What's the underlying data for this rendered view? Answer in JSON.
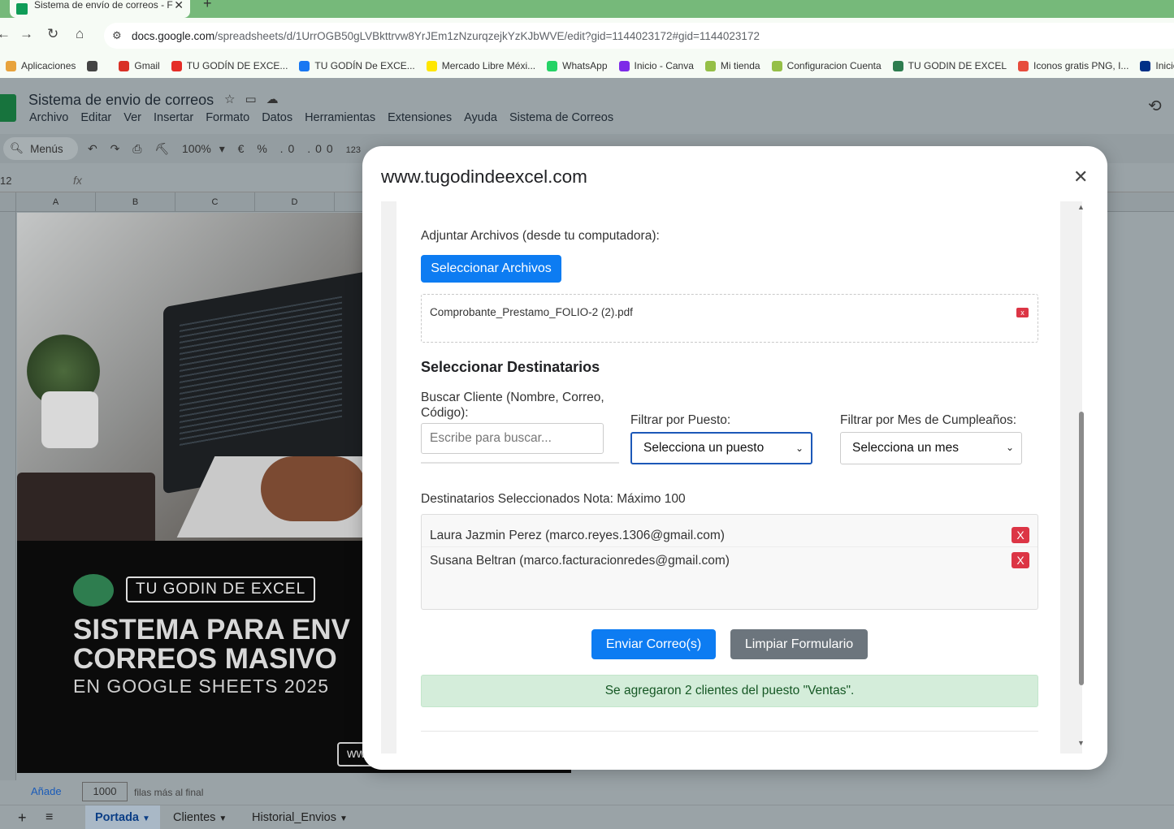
{
  "browser": {
    "tab_title": "Sistema de envío de correos - F",
    "tab_close": "✕",
    "new_tab": "+",
    "url_domain": "docs.google.com",
    "url_path": "/spreadsheets/d/1UrrOGB50gLVBkttrvw8YrJEm1zNzurqzejkYzKJbWVE/edit?gid=1144023172#gid=1144023172",
    "bookmarks": [
      {
        "label": "Aplicaciones",
        "color": "#e8a33d"
      },
      {
        "label": "",
        "color": "#444444"
      },
      {
        "label": "Gmail",
        "color": "#d93025"
      },
      {
        "label": "TU GODÍN DE EXCE...",
        "color": "#e52d27"
      },
      {
        "label": "TU GODÍN De EXCE...",
        "color": "#1877f2"
      },
      {
        "label": "Mercado Libre Méxi...",
        "color": "#ffe600"
      },
      {
        "label": "WhatsApp",
        "color": "#25d366"
      },
      {
        "label": "Inicio - Canva",
        "color": "#7d2ae8"
      },
      {
        "label": "Mi tienda",
        "color": "#95bf47"
      },
      {
        "label": "Configuracion Cuenta",
        "color": "#95bf47"
      },
      {
        "label": "TU GODIN DE EXCEL",
        "color": "#2e7d4f"
      },
      {
        "label": "Iconos gratis PNG, I...",
        "color": "#e74c3c"
      },
      {
        "label": "Inicio - Pa",
        "color": "#003087"
      }
    ]
  },
  "sheets": {
    "doc_title": "Sistema de envio de correos",
    "menu": [
      "Archivo",
      "Editar",
      "Ver",
      "Insertar",
      "Formato",
      "Datos",
      "Herramientas",
      "Extensiones",
      "Ayuda",
      "Sistema de Correos"
    ],
    "search_label": "Menús",
    "zoom": "100%",
    "currency": "€",
    "percent": "%",
    "number_format": "123",
    "name_box": "12",
    "fx": "fx",
    "columns": [
      "A",
      "B",
      "C",
      "D"
    ],
    "banner": {
      "badge": "TU GODIN DE EXCEL",
      "title_line1": "SISTEMA PARA ENV",
      "title_line2": "CORREOS MASIVO",
      "subtitle": "EN GOOGLE SHEETS 2025",
      "web": "ww"
    },
    "add_rows_label": "Añade",
    "add_rows_value": "1000",
    "add_rows_suffix": "filas más al final",
    "sheet_tabs": [
      "Portada",
      "Clientes",
      "Historial_Envios"
    ]
  },
  "modal": {
    "title": "www.tugodindeexcel.com",
    "close": "✕",
    "attach_label": "Adjuntar Archivos (desde tu computadora):",
    "select_files_button": "Seleccionar Archivos",
    "attached_file": "Comprobante_Prestamo_FOLIO-2 (2).pdf",
    "remove_x": "x",
    "recipients_heading": "Seleccionar Destinatarios",
    "search_client_label": "Buscar Cliente (Nombre, Correo, Código):",
    "search_placeholder": "Escribe para buscar...",
    "filter_position_label": "Filtrar por Puesto:",
    "filter_position_value": "Selecciona un puesto",
    "filter_month_label": "Filtrar por Mes de Cumpleaños:",
    "filter_month_value": "Selecciona un mes",
    "selected_label": "Destinatarios Seleccionados Nota: Máximo 100",
    "recipients": [
      {
        "text": "Laura Jazmin Perez (marco.reyes.1306@gmail.com)",
        "remove": "X"
      },
      {
        "text": "Susana Beltran (marco.facturacionredes@gmail.com)",
        "remove": "X"
      }
    ],
    "send_button": "Enviar Correo(s)",
    "clear_button": "Limpiar Formulario",
    "status_message": "Se agregaron 2 clientes del puesto \"Ventas\"."
  }
}
